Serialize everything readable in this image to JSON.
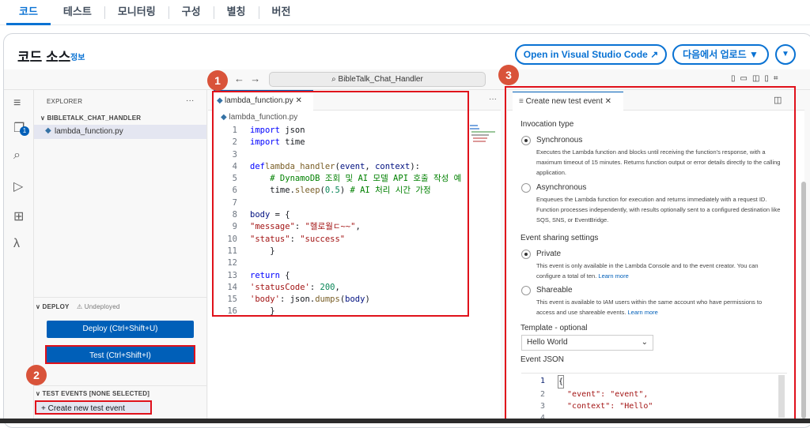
{
  "tabs": [
    "코드",
    "테스트",
    "모니터링",
    "구성",
    "별칭",
    "버전"
  ],
  "header": {
    "title": "코드 소스",
    "info": "정보",
    "open_vscode": "Open in Visual Studio Code ↗",
    "upload": "다음에서 업로드 ▼",
    "more": "▼"
  },
  "ide": {
    "command_center": "⌕ BibleTalk_Chat_Handler",
    "explorer": {
      "title": "EXPLORER",
      "folder": "∨ BIBLETALK_CHAT_HANDLER",
      "file": "lambda_function.py",
      "more": "···"
    },
    "deploy": {
      "title": "∨ DEPLOY",
      "status": "⚠ Undeployed",
      "deploy_button": "Deploy (Ctrl+Shift+U)",
      "test_button": "Test (Ctrl+Shift+I)"
    },
    "test_events": {
      "title": "∨ TEST EVENTS [NONE SELECTED]",
      "create": "+ Create new test event"
    },
    "editor": {
      "tab": "lambda_function.py  ✕",
      "breadcrumb": "lambda_function.py"
    },
    "code_lines": [
      [
        "1",
        "import json"
      ],
      [
        "2",
        "import time"
      ],
      [
        "3",
        ""
      ],
      [
        "4",
        "def lambda_handler(event, context):"
      ],
      [
        "5",
        "    # DynamoDB 조회 및 AI 모델 API 호출 작성 예"
      ],
      [
        "6",
        "    time.sleep(0.5) # AI 처리 시간 가정"
      ],
      [
        "7",
        ""
      ],
      [
        "8",
        "    body = {"
      ],
      [
        "9",
        "        \"message\": \"헬로월ㄷ~~\","
      ],
      [
        "10",
        "        \"status\": \"success\""
      ],
      [
        "11",
        "    }"
      ],
      [
        "12",
        ""
      ],
      [
        "13",
        "    return {"
      ],
      [
        "14",
        "        'statusCode': 200,"
      ],
      [
        "15",
        "        'body': json.dumps(body)"
      ],
      [
        "16",
        "    }"
      ]
    ],
    "test_panel": {
      "tab": "Create new test event  ✕",
      "invocation_type": "Invocation type",
      "sync_label": "Synchronous",
      "sync_desc": "Executes the Lambda function and blocks until receiving the function's response, with a maximum timeout of 15 minutes. Returns function output or error details directly to the calling application.",
      "async_label": "Asynchronous",
      "async_desc": "Enqueues the Lambda function for execution and returns immediately with a request ID. Function processes independently, with results optionally sent to a configured destination like SQS, SNS, or EventBridge.",
      "sharing": "Event sharing settings",
      "private_label": "Private",
      "private_desc": "This event is only available in the Lambda Console and to the event creator. You can configure a total of ten.",
      "shareable_label": "Shareable",
      "shareable_desc": "This event is available to IAM users within the same account who have permissions to access and use shareable events.",
      "learn_more": "Learn more",
      "template_label": "Template - optional",
      "template_value": "Hello World",
      "event_json": "Event JSON",
      "json_lines": [
        [
          "1",
          "{"
        ],
        [
          "2",
          "  \"event\": \"event\","
        ],
        [
          "3",
          "  \"context\": \"Hello\""
        ],
        [
          "4",
          ""
        ]
      ]
    }
  },
  "markers": [
    "1",
    "2",
    "3"
  ]
}
